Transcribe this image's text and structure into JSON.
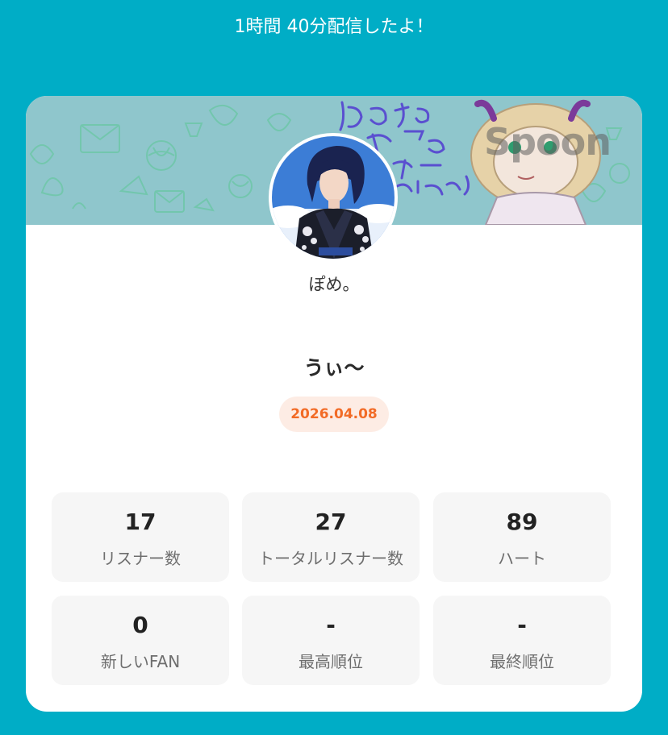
{
  "header": {
    "message": "1時間 40分配信したよ！"
  },
  "banner": {
    "brand": "Spoon",
    "background_color": "#8fc6cc"
  },
  "profile": {
    "username": "ぽめ。",
    "avatar_icon": "user-avatar"
  },
  "broadcast": {
    "title": "うぃ〜",
    "date": "2026.04.08"
  },
  "stats": [
    {
      "value": "17",
      "label": "リスナー数"
    },
    {
      "value": "27",
      "label": "トータルリスナー数"
    },
    {
      "value": "89",
      "label": "ハート"
    },
    {
      "value": "0",
      "label": "新しいFAN"
    },
    {
      "value": "-",
      "label": "最高順位"
    },
    {
      "value": "-",
      "label": "最終順位"
    }
  ],
  "colors": {
    "page_background": "#00adc6",
    "card_background": "#ffffff",
    "accent": "#f26b26",
    "badge_background": "#fdece4",
    "stat_tile": "#f6f6f6"
  }
}
